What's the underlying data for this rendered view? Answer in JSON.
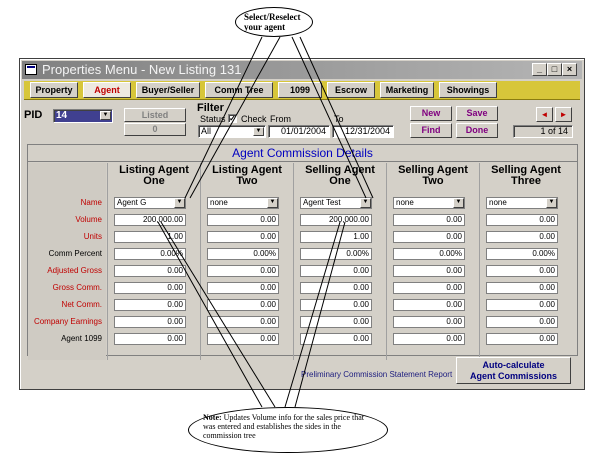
{
  "callouts": {
    "top": "Select/Reselect your agent",
    "bottom_note_label": "Note:",
    "bottom_note_text": "Updates Volume info for the sales price that was entered and establishes the sides in the commission tree"
  },
  "window": {
    "title": "Properties Menu - New Listing 131",
    "controls": [
      "_",
      "□",
      "×"
    ]
  },
  "nav_tabs": [
    {
      "label": "Property",
      "active": false
    },
    {
      "label": "Agent",
      "active": true
    },
    {
      "label": "Buyer/Seller",
      "active": false
    },
    {
      "label": "Comm Tree",
      "active": false
    },
    {
      "label": "1099",
      "active": false
    },
    {
      "label": "Escrow",
      "active": false
    },
    {
      "label": "Marketing",
      "active": false
    },
    {
      "label": "Showings",
      "active": false
    }
  ],
  "pid": {
    "label": "PID",
    "value": "14"
  },
  "listed": {
    "label": "Listed",
    "count": "0"
  },
  "filter": {
    "title": "Filter",
    "status_label": "Status",
    "status_value": "All",
    "check_label": "Check",
    "checked": "✓",
    "from_label": "From",
    "from_value": "01/01/2004",
    "to_label": "To",
    "to_value": "12/31/2004"
  },
  "actions": {
    "new": "New",
    "save": "Save",
    "find": "Find",
    "done": "Done"
  },
  "record_nav": {
    "prev": "◄",
    "next": "►",
    "counter": "1 of 14"
  },
  "details": {
    "title": "Agent Commission Details",
    "row_labels": [
      {
        "text": "Name",
        "color": "#c00000"
      },
      {
        "text": "Volume",
        "color": "#c00000"
      },
      {
        "text": "Units",
        "color": "#c00000"
      },
      {
        "text": "Comm Percent",
        "color": "#000000"
      },
      {
        "text": "Adjusted Gross",
        "color": "#c00000"
      },
      {
        "text": "Gross Comm.",
        "color": "#c00000"
      },
      {
        "text": "Net Comm.",
        "color": "#c00000"
      },
      {
        "text": "Company Earnings",
        "color": "#c00000"
      },
      {
        "text": "Agent 1099",
        "color": "#000000"
      }
    ],
    "columns": [
      {
        "head1": "Listing Agent",
        "head2": "One",
        "name": "Agent G",
        "values": [
          "200,000.00",
          "1.00",
          "0.00%",
          "0.00",
          "0.00",
          "0.00",
          "0.00",
          "0.00"
        ]
      },
      {
        "head1": "Listing Agent",
        "head2": "Two",
        "name": "none",
        "values": [
          "0.00",
          "0.00",
          "0.00%",
          "0.00",
          "0.00",
          "0.00",
          "0.00",
          "0.00"
        ]
      },
      {
        "head1": "Selling Agent",
        "head2": "One",
        "name": "Agent Test",
        "values": [
          "200,000.00",
          "1.00",
          "0.00%",
          "0.00",
          "0.00",
          "0.00",
          "0.00",
          "0.00"
        ]
      },
      {
        "head1": "Selling Agent",
        "head2": "Two",
        "name": "none",
        "values": [
          "0.00",
          "0.00",
          "0.00%",
          "0.00",
          "0.00",
          "0.00",
          "0.00",
          "0.00"
        ]
      },
      {
        "head1": "Selling Agent",
        "head2": "Three",
        "name": "none",
        "values": [
          "0.00",
          "0.00",
          "0.00%",
          "0.00",
          "0.00",
          "0.00",
          "0.00",
          "0.00"
        ]
      }
    ]
  },
  "bottom": {
    "report_link": "Preliminary Commission Statement Report",
    "autocalc_line1": "Auto-calculate",
    "autocalc_line2": "Agent Commissions"
  },
  "colors": {
    "accent_red": "#c00000",
    "action_purple": "#800080",
    "title_blue": "#0000c0",
    "tab_strip": "#d7c63a"
  }
}
